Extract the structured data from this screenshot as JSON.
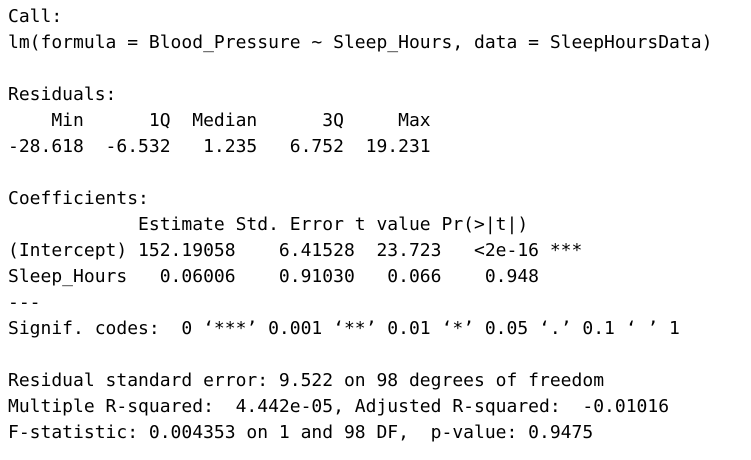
{
  "call": {
    "header": "Call:",
    "formula": "lm(formula = Blood_Pressure ~ Sleep_Hours, data = SleepHoursData)"
  },
  "residuals": {
    "header": "Residuals:",
    "labels": "    Min      1Q  Median      3Q     Max ",
    "values": "-28.618  -6.532   1.235   6.752  19.231 "
  },
  "coefficients": {
    "header": "Coefficients:",
    "column_header": "            Estimate Std. Error t value Pr(>|t|)    ",
    "rows": [
      "(Intercept) 152.19058    6.41528  23.723   <2e-16 ***",
      "Sleep_Hours   0.06006    0.91030   0.066    0.948    "
    ],
    "separator": "---",
    "signif_codes": "Signif. codes:  0 ‘***’ 0.001 ‘**’ 0.01 ‘*’ 0.05 ‘.’ 0.1 ‘ ’ 1"
  },
  "summary": {
    "rse": "Residual standard error: 9.522 on 98 degrees of freedom",
    "r_squared": "Multiple R-squared:  4.442e-05,\tAdjusted R-squared:  -0.01016 ",
    "f_statistic": "F-statistic: 0.004353 on 1 and 98 DF,  p-value: 0.9475"
  }
}
